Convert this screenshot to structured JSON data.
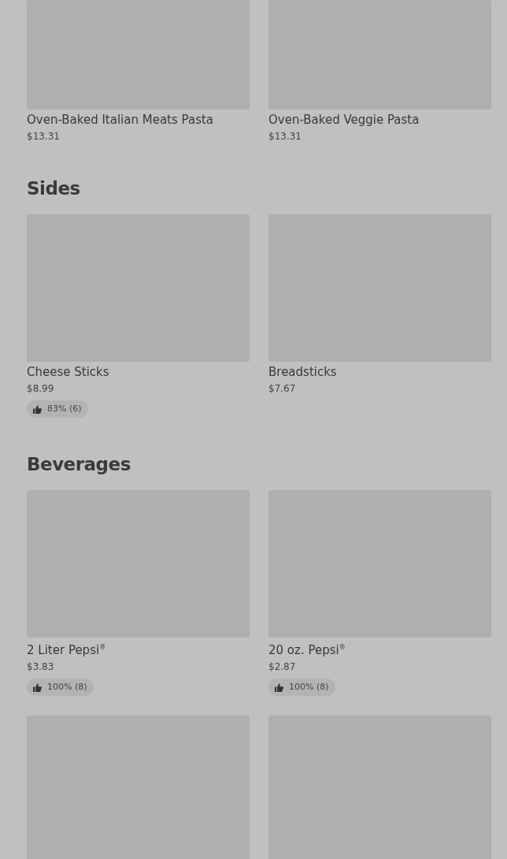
{
  "sections": [
    {
      "items": [
        {
          "kind": "dish",
          "name": "Oven-Baked Italian Meats Pasta",
          "price": "$13.31"
        },
        {
          "kind": "dish",
          "name": "Oven-Baked Veggie Pasta",
          "price": "$13.31"
        }
      ]
    },
    {
      "title": "Sides",
      "items": [
        {
          "kind": "dish",
          "name": "Cheese Sticks",
          "price": "$8.99",
          "rating": "83% (6)"
        },
        {
          "kind": "dish",
          "name": "Breadsticks",
          "price": "$7.67"
        }
      ]
    },
    {
      "title": "Beverages",
      "items": [
        {
          "kind": "dish",
          "name": "2 Liter Pepsi$^{®}$",
          "price": "$3.83",
          "rating": "100% (8)"
        },
        {
          "kind": "dish",
          "name": "20 oz. Pepsi$^{®}$",
          "price": "$2.87",
          "rating": "100% (8)"
        },
        {
          "kind": "picture"
        },
        {
          "kind": "picture"
        }
      ]
    }
  ]
}
